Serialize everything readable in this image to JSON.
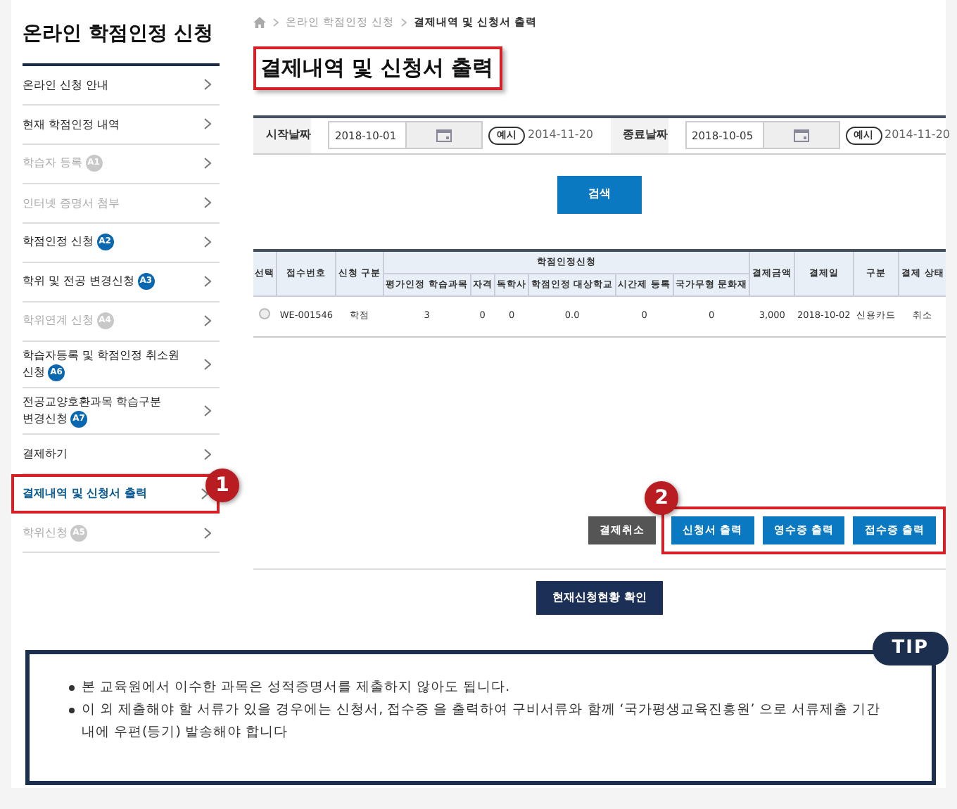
{
  "sidebar": {
    "title": "온라인 학점인정 신청",
    "items": [
      {
        "label": "온라인 신청 안내",
        "disabled": false,
        "selected": false,
        "highlighted": false
      },
      {
        "label": "현재 학점인정 내역",
        "disabled": false,
        "selected": false,
        "highlighted": false
      },
      {
        "label": "학습자 등록",
        "badge": "A1",
        "disabled": true,
        "selected": false,
        "highlighted": false
      },
      {
        "label": "인터넷 증명서 첨부",
        "disabled": true,
        "selected": false,
        "highlighted": false
      },
      {
        "label": "학점인정 신청",
        "badge": "A2",
        "disabled": false,
        "selected": false,
        "highlighted": false
      },
      {
        "label": "학위 및 전공 변경신청",
        "badge": "A3",
        "disabled": false,
        "selected": false,
        "highlighted": false
      },
      {
        "label": "학위연계 신청",
        "badge": "A4",
        "disabled": true,
        "selected": false,
        "highlighted": false
      },
      {
        "label": "학습자등록 및 학점인정 취소원 신청",
        "badge": "A6",
        "disabled": false,
        "selected": false,
        "highlighted": false
      },
      {
        "label": "전공교양호환과목 학습구분 변경신청",
        "badge": "A7",
        "disabled": false,
        "selected": false,
        "highlighted": false
      },
      {
        "label": "결제하기",
        "disabled": false,
        "selected": false,
        "highlighted": false
      },
      {
        "label": "결제내역 및 신청서 출력",
        "disabled": false,
        "selected": true,
        "highlighted": true,
        "callout": "1"
      },
      {
        "label": "학위신청",
        "badge": "A5",
        "disabled": true,
        "selected": false,
        "highlighted": false
      }
    ]
  },
  "breadcrumb": [
    "온라인 학점인정 신청",
    "결제내역 및 신청서 출력"
  ],
  "page_title": {
    "text": "결제내역 및 신청서 출력",
    "highlighted": true
  },
  "filter": [
    {
      "label": "시작날짜",
      "value": "2018-10-01",
      "example_tag": "예시",
      "example": "2014-11-20"
    },
    {
      "label": "종료날짜",
      "value": "2018-10-05",
      "example_tag": "예시",
      "example": "2014-11-20"
    }
  ],
  "search_button": "검색",
  "table": {
    "column_group": "학점인정신청",
    "columns": [
      {
        "label": "선택",
        "kind": "radio"
      },
      {
        "label": "접수번호"
      },
      {
        "label": "신청 구분"
      },
      {
        "label": "평가인정 학습과목",
        "grouped": true
      },
      {
        "label": "자격",
        "grouped": true
      },
      {
        "label": "독학사",
        "grouped": true
      },
      {
        "label": "학점인정 대상학교",
        "grouped": true
      },
      {
        "label": "시간제 등록",
        "grouped": true
      },
      {
        "label": "국가무형 문화재",
        "grouped": true
      },
      {
        "label": "결제금액"
      },
      {
        "label": "결제일"
      },
      {
        "label": "구분"
      },
      {
        "label": "결제 상태"
      }
    ],
    "rows": [
      {
        "selected": false,
        "cells": [
          "",
          "WE-001546",
          "학점",
          "3",
          "0",
          "0",
          "0.0",
          "0",
          "0",
          "3,000",
          "2018-10-02",
          "신용카드",
          "취소"
        ]
      }
    ]
  },
  "actions": {
    "buttons": [
      {
        "label": "결제취소",
        "kind": "dark"
      },
      {
        "label": "신청서 출력",
        "kind": "primary"
      },
      {
        "label": "영수증 출력",
        "kind": "primary"
      },
      {
        "label": "접수증 출력",
        "kind": "primary"
      }
    ],
    "highlighted": true,
    "callout": "2"
  },
  "status_button": "현재신청현황 확인",
  "tip": {
    "tag": "TIP",
    "lines": [
      "본 교육원에서 이수한 과목은 성적증명서를 제출하지 않아도 됩니다.",
      "이 외 제출해야 할 서류가 있을 경우에는 신청서, 접수증 을 출력하여 구비서류와  함께 ‘국가평생교육진흥원’ 으로 서류제출 기간 내에 우편(등기) 발송해야 합니다"
    ]
  }
}
